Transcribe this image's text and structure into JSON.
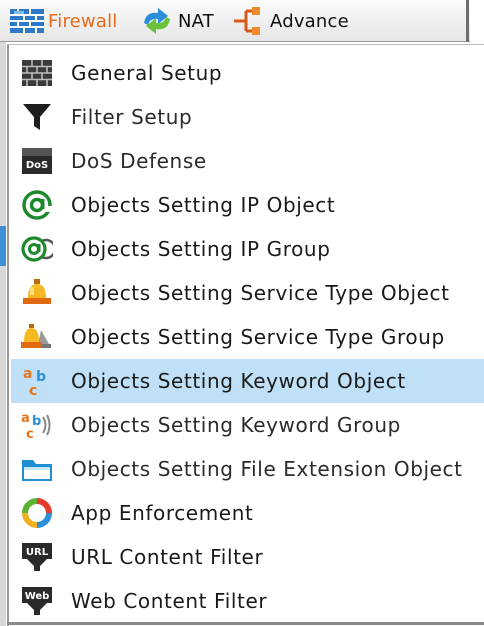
{
  "menubar": {
    "tabs": [
      {
        "label": "Firewall",
        "icon": "firewall-brick-icon",
        "color": "#e66a1a"
      },
      {
        "label": "NAT",
        "icon": "nat-arrows-icon"
      },
      {
        "label": "Advance",
        "icon": "advance-network-icon"
      }
    ]
  },
  "dropdown": {
    "selected_index": 7,
    "selected_color": "#bfe0f6",
    "items": [
      {
        "label": "General Setup",
        "icon": "brick-wall-icon"
      },
      {
        "label": "Filter Setup",
        "icon": "funnel-icon"
      },
      {
        "label": "DoS Defense",
        "icon": "dos-badge-icon"
      },
      {
        "label": "Objects Setting IP Object",
        "icon": "at-sign-icon"
      },
      {
        "label": "Objects Setting IP Group",
        "icon": "at-sign-group-icon"
      },
      {
        "label": "Objects Setting Service Type Object",
        "icon": "bell-icon"
      },
      {
        "label": "Objects Setting Service Type Group",
        "icon": "bell-group-icon"
      },
      {
        "label": "Objects Setting Keyword Object",
        "icon": "abc-letters-icon"
      },
      {
        "label": "Objects Setting Keyword Group",
        "icon": "abc-letters-group-icon"
      },
      {
        "label": "Objects Setting File Extension Object",
        "icon": "folder-icon"
      },
      {
        "label": "App Enforcement",
        "icon": "ring-segments-icon"
      },
      {
        "label": "URL Content Filter",
        "icon": "url-badge-icon"
      },
      {
        "label": "Web Content Filter",
        "icon": "web-badge-icon"
      }
    ]
  }
}
